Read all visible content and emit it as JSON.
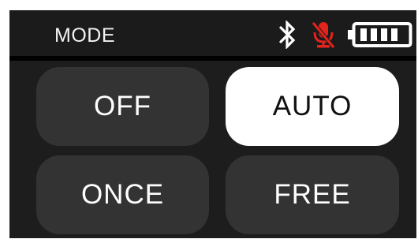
{
  "header": {
    "title": "MODE",
    "icons": [
      "bluetooth-icon",
      "mic-muted-icon",
      "battery-icon"
    ],
    "mic_status_color": "#e3231c",
    "battery_level": 1.0
  },
  "modes": {
    "off": "OFF",
    "auto": "AUTO",
    "once": "ONCE",
    "free": "FREE",
    "selected": "AUTO"
  }
}
